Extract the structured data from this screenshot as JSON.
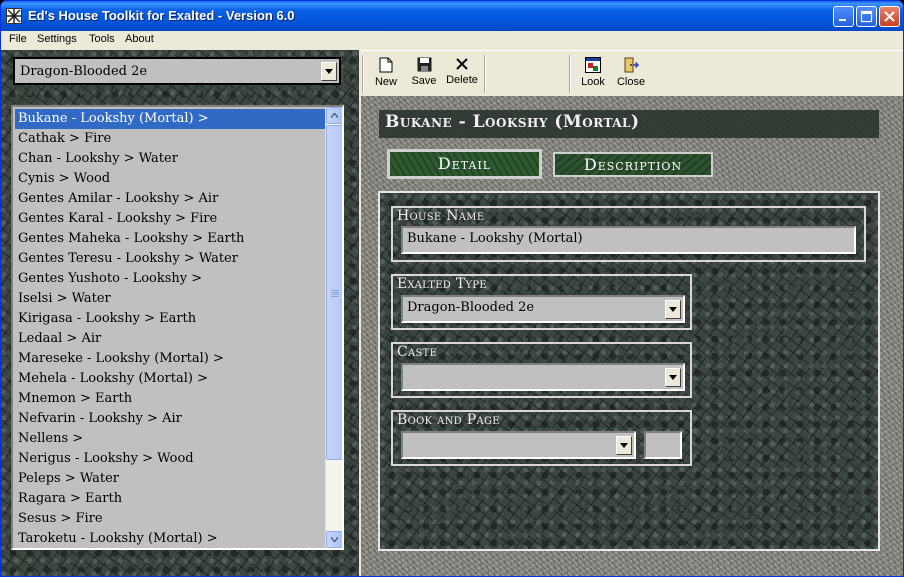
{
  "window": {
    "title": "Ed's House Toolkit for Exalted - Version 6.0"
  },
  "menu": [
    "File",
    "Settings",
    "Tools",
    "About"
  ],
  "toolbar": {
    "new": "New",
    "save": "Save",
    "delete": "Delete",
    "look": "Look",
    "close": "Close"
  },
  "filter": {
    "selected": "Dragon-Blooded 2e"
  },
  "houses": [
    "Bukane - Lookshy (Mortal) >",
    "Cathak > Fire",
    "Chan - Lookshy > Water",
    "Cynis > Wood",
    "Gentes Amilar - Lookshy > Air",
    "Gentes Karal - Lookshy > Fire",
    "Gentes Maheka - Lookshy > Earth",
    "Gentes Teresu - Lookshy > Water",
    "Gentes Yushoto - Lookshy >",
    "Iselsi > Water",
    "Kirigasa - Lookshy > Earth",
    "Ledaal > Air",
    "Mareseke - Lookshy (Mortal) >",
    "Mehela - Lookshy (Mortal) >",
    "Mnemon > Earth",
    "Nefvarin - Lookshy > Air",
    "Nellens >",
    "Nerigus - Lookshy > Wood",
    "Peleps > Water",
    "Ragara > Earth",
    "Sesus > Fire",
    "Taroketu - Lookshy (Mortal) >"
  ],
  "selected_index": 0,
  "detail": {
    "header": "Bukane - Lookshy (Mortal)",
    "tabs": {
      "detail": "Detail",
      "description": "Description"
    },
    "house_name_label": "House Name",
    "house_name_value": "Bukane - Lookshy (Mortal)",
    "exalted_type_label": "Exalted Type",
    "exalted_type_value": "Dragon-Blooded 2e",
    "caste_label": "Caste",
    "caste_value": "",
    "book_label": "Book and Page",
    "book_value": "",
    "page_value": ""
  },
  "colors": {
    "titlebar": "#0455d8",
    "selection": "#316ac5",
    "list_bg": "#c0c0c0"
  }
}
